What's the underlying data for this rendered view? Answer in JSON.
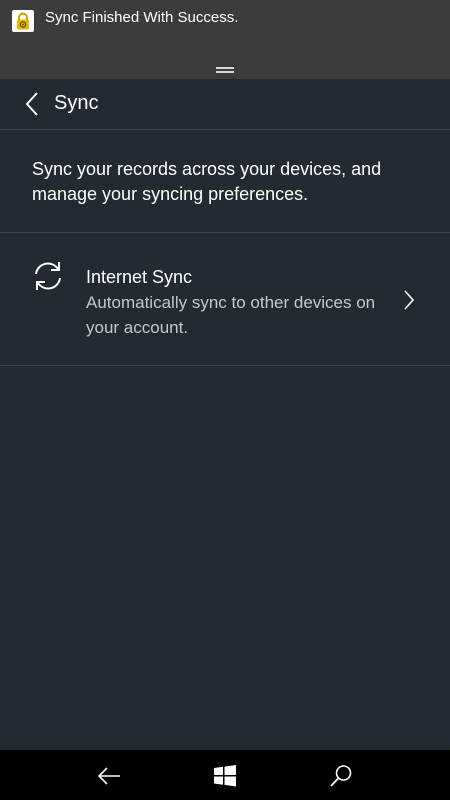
{
  "notification": {
    "text": "Sync Finished With Success.",
    "icon": "lock-app-icon"
  },
  "header": {
    "title": "Sync",
    "back_icon": "chevron-left-icon"
  },
  "description": "Sync your records across your devices, and manage your syncing preferences.",
  "settings": [
    {
      "icon": "sync-icon",
      "title": "Internet Sync",
      "subtitle": "Automatically sync to other devices on your account."
    }
  ],
  "navbar": {
    "buttons": [
      "back-arrow-icon",
      "windows-start-icon",
      "search-icon"
    ]
  },
  "colors": {
    "background": "#232a31",
    "toast_background": "#3c3c3c",
    "divider": "#3d454d",
    "navbar": "#000000",
    "lock_icon": "#e5b800"
  }
}
